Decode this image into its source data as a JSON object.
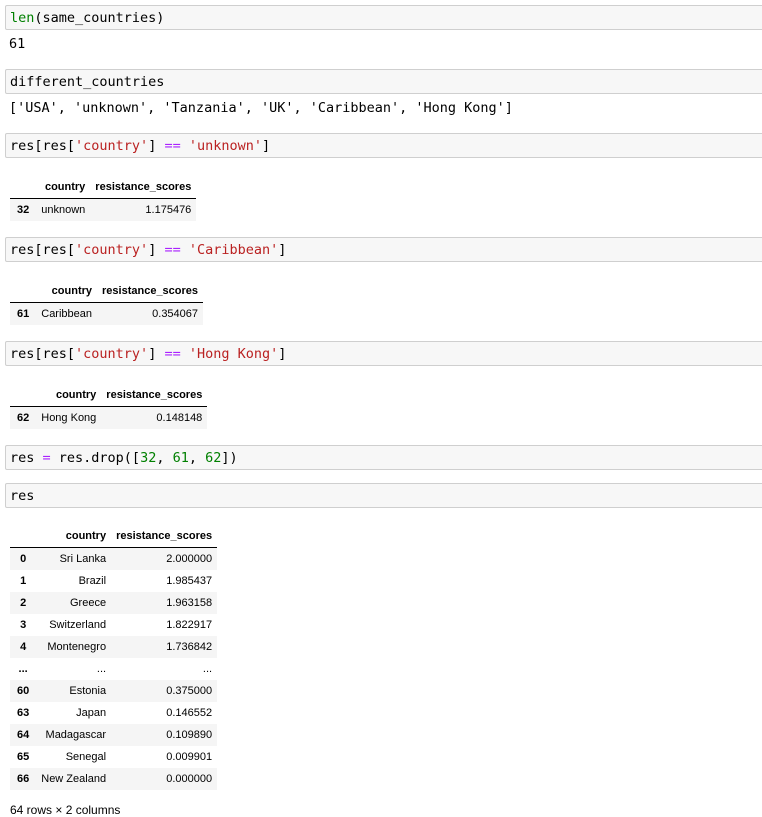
{
  "cells": [
    {
      "code": [
        [
          "kw",
          "len"
        ],
        [
          "",
          "(same_countries)"
        ]
      ],
      "output": "61"
    },
    {
      "code": [
        [
          "",
          "different_countries"
        ]
      ],
      "output": "['USA', 'unknown', 'Tanzania', 'UK', 'Caribbean', 'Hong Kong']"
    },
    {
      "code": [
        [
          "",
          "res[res["
        ],
        [
          "str",
          "'country'"
        ],
        [
          "",
          "] "
        ],
        [
          "op",
          "=="
        ],
        [
          "",
          ""
        ],
        [
          "str",
          " 'unknown'"
        ],
        [
          "",
          "]"
        ]
      ]
    },
    {
      "code": [
        [
          "",
          "res[res["
        ],
        [
          "str",
          "'country'"
        ],
        [
          "",
          "] "
        ],
        [
          "op",
          "=="
        ],
        [
          "str",
          " 'Caribbean'"
        ],
        [
          "",
          "]"
        ]
      ]
    },
    {
      "code": [
        [
          "",
          "res[res["
        ],
        [
          "str",
          "'country'"
        ],
        [
          "",
          "] "
        ],
        [
          "op",
          "=="
        ],
        [
          "str",
          " 'Hong Kong'"
        ],
        [
          "",
          "]"
        ]
      ]
    },
    {
      "code": [
        [
          "",
          "res "
        ],
        [
          "op",
          "="
        ],
        [
          "",
          " res.drop(["
        ],
        [
          "num",
          "32"
        ],
        [
          "",
          ", "
        ],
        [
          "num",
          "61"
        ],
        [
          "",
          ", "
        ],
        [
          "num",
          "62"
        ],
        [
          "",
          "])"
        ]
      ]
    },
    {
      "code": [
        [
          "",
          "res"
        ]
      ]
    }
  ],
  "columns": [
    "country",
    "resistance_scores"
  ],
  "table_unknown": [
    [
      "32",
      "unknown",
      "1.175476"
    ]
  ],
  "table_caribbean": [
    [
      "61",
      "Caribbean",
      "0.354067"
    ]
  ],
  "table_hongkong": [
    [
      "62",
      "Hong Kong",
      "0.148148"
    ]
  ],
  "table_res": [
    [
      "0",
      "Sri Lanka",
      "2.000000"
    ],
    [
      "1",
      "Brazil",
      "1.985437"
    ],
    [
      "2",
      "Greece",
      "1.963158"
    ],
    [
      "3",
      "Switzerland",
      "1.822917"
    ],
    [
      "4",
      "Montenegro",
      "1.736842"
    ],
    [
      "...",
      "...",
      "..."
    ],
    [
      "60",
      "Estonia",
      "0.375000"
    ],
    [
      "63",
      "Japan",
      "0.146552"
    ],
    [
      "64",
      "Madagascar",
      "0.109890"
    ],
    [
      "65",
      "Senegal",
      "0.009901"
    ],
    [
      "66",
      "New Zealand",
      "0.000000"
    ]
  ],
  "footer": "64 rows × 2 columns"
}
